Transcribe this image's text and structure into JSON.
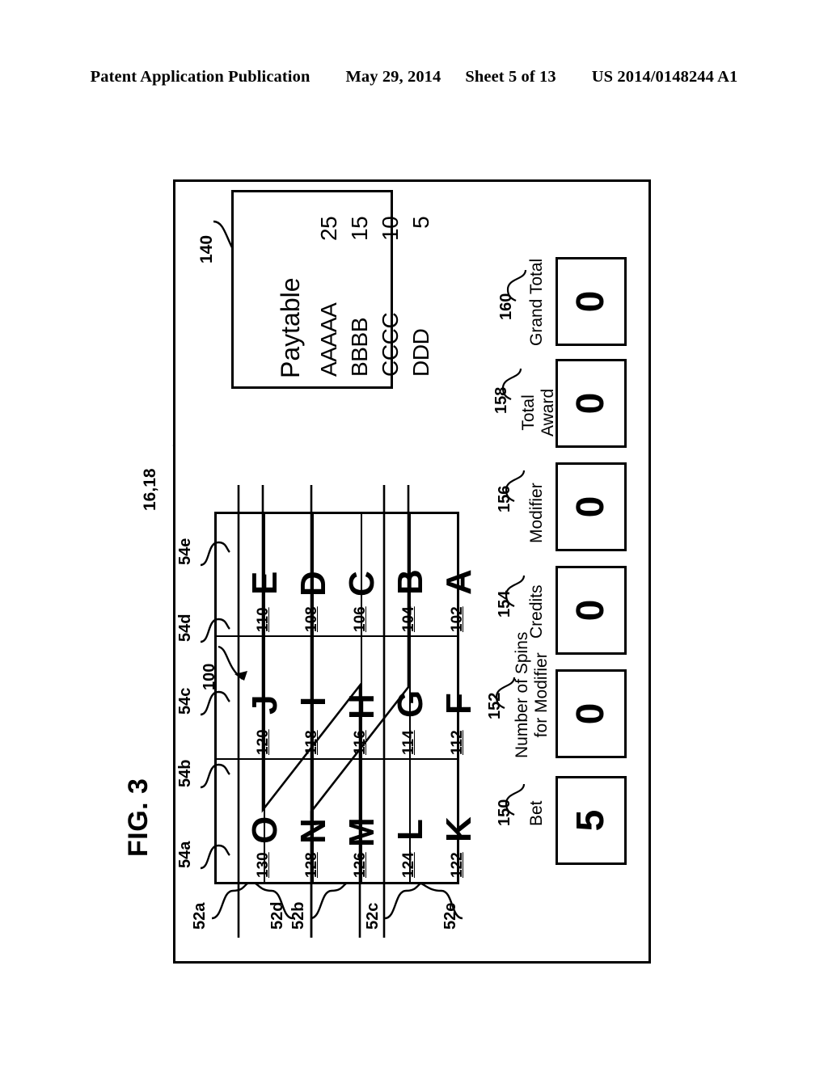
{
  "header": {
    "publication": "Patent Application Publication",
    "date": "May 29, 2014",
    "sheet": "Sheet 5 of 13",
    "patent_number": "US 2014/0148244 A1"
  },
  "figure": {
    "label": "FIG. 3",
    "device_ref": "16,18",
    "grid_ref": "100",
    "paytable_ref": "140"
  },
  "paytable": {
    "title": "Paytable",
    "rows": [
      {
        "symbol": "AAAAA",
        "value": "25"
      },
      {
        "symbol": "BBBB",
        "value": "15"
      },
      {
        "symbol": "CCCC",
        "value": "10"
      },
      {
        "symbol": "DDD",
        "value": "5"
      }
    ]
  },
  "reels": {
    "rows": [
      {
        "ref": "54a",
        "cells": [
          {
            "symbol": "A",
            "ref": "102"
          },
          {
            "symbol": "B",
            "ref": "104"
          },
          {
            "symbol": "C",
            "ref": "106"
          },
          {
            "symbol": "D",
            "ref": "108"
          },
          {
            "symbol": "E",
            "ref": "110"
          }
        ]
      },
      {
        "ref": "54b",
        "cells": [
          {
            "symbol": "F",
            "ref": "112"
          },
          {
            "symbol": "G",
            "ref": "114"
          },
          {
            "symbol": "H",
            "ref": "116"
          },
          {
            "symbol": "I",
            "ref": "118"
          },
          {
            "symbol": "J",
            "ref": "120"
          }
        ]
      },
      {
        "ref": "54c",
        "cells": [
          {
            "symbol": "K",
            "ref": "122"
          },
          {
            "symbol": "L",
            "ref": "124"
          },
          {
            "symbol": "M",
            "ref": "126"
          },
          {
            "symbol": "N",
            "ref": "128"
          },
          {
            "symbol": "O",
            "ref": "130"
          }
        ]
      }
    ],
    "row_refs": [
      "54a",
      "54b",
      "54c",
      "54d",
      "54e"
    ],
    "payline_refs": [
      "52a",
      "52b",
      "52c",
      "52d",
      "52e"
    ]
  },
  "meters": [
    {
      "ref": "150",
      "label": "Bet",
      "value": "5"
    },
    {
      "ref": "152",
      "label": "Number of Spins\nfor Modifier",
      "value": "0"
    },
    {
      "ref": "154",
      "label": "Credits",
      "value": "0"
    },
    {
      "ref": "156",
      "label": "Modifier",
      "value": "0"
    },
    {
      "ref": "158",
      "label": "Total\nAward",
      "value": "0"
    },
    {
      "ref": "160",
      "label": "Grand Total",
      "value": "0"
    }
  ],
  "colors": {
    "ink": "#000000",
    "paper": "#ffffff"
  }
}
